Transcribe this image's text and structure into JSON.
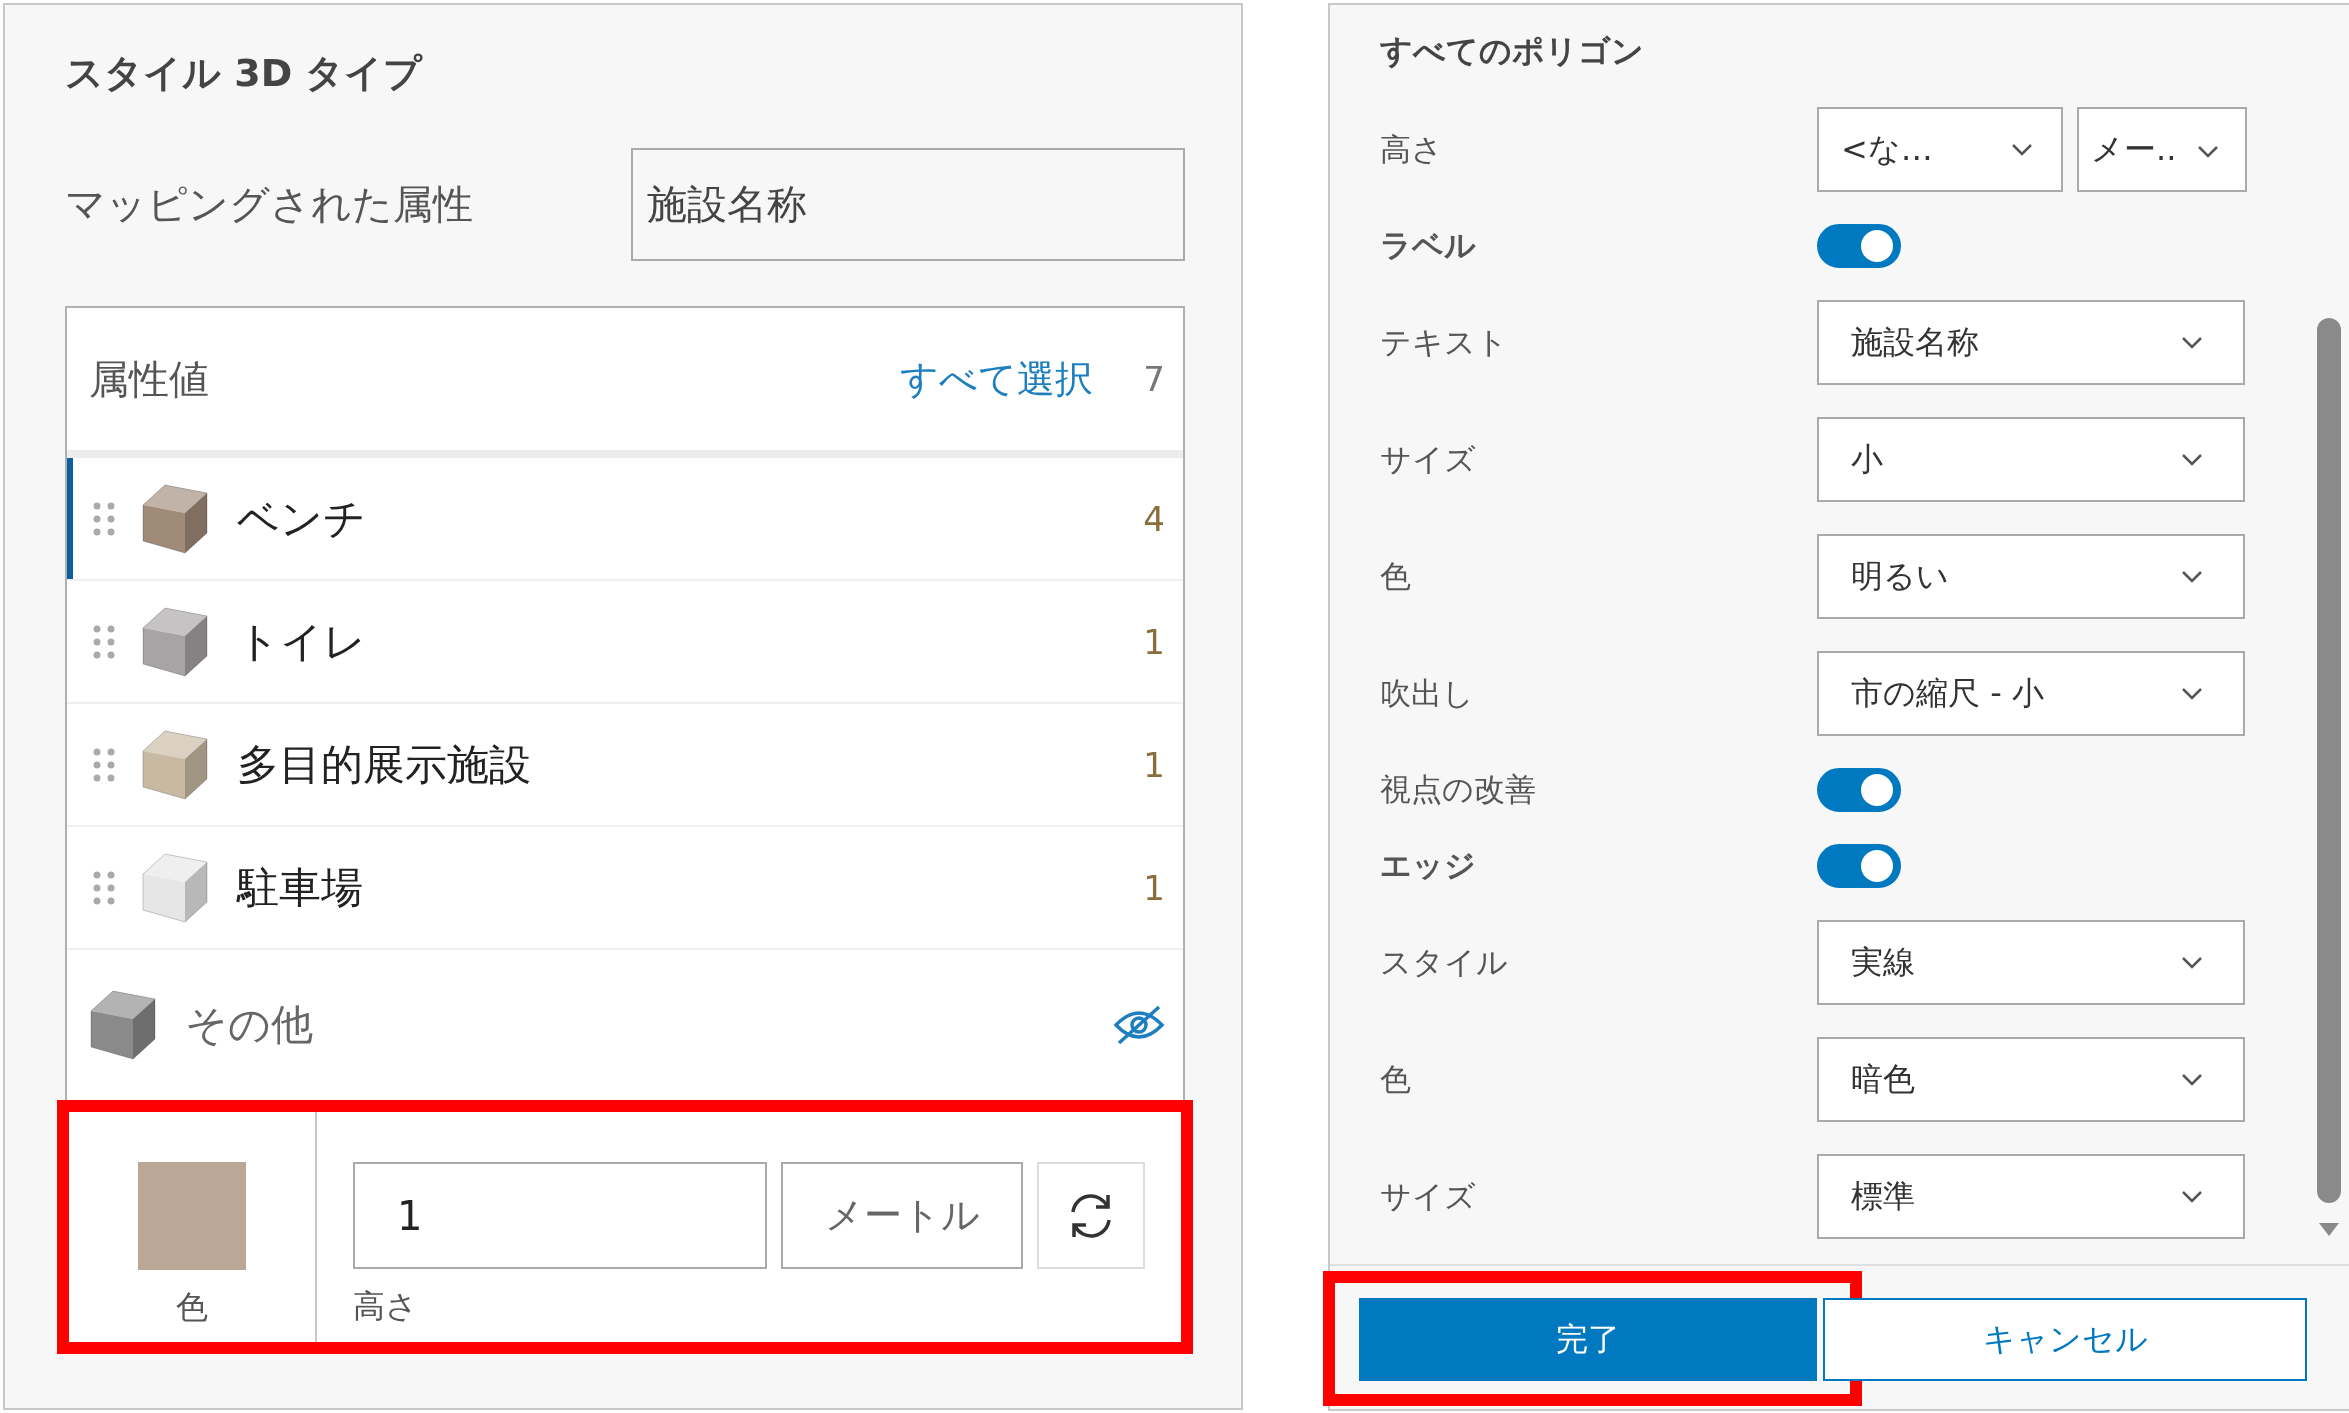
{
  "style_panel": {
    "title": "スタイル 3D タイプ",
    "mapped_attribute": {
      "label": "マッピングされた属性",
      "value": "施設名称"
    },
    "values_list": {
      "header": "属性値",
      "select_all": "すべて選択",
      "total": "7",
      "items": [
        {
          "label": "ベンチ",
          "count": "4",
          "color": "#a08a78",
          "selected": true
        },
        {
          "label": "トイレ",
          "count": "1",
          "color": "#a8a3a5",
          "selected": false
        },
        {
          "label": "多目的展示施設",
          "count": "1",
          "color": "#c8b9a3",
          "selected": false
        },
        {
          "label": "駐車場",
          "count": "1",
          "color": "#e6e6e6",
          "selected": false
        }
      ],
      "other": {
        "label": "その他",
        "color": "#8a8a8a",
        "hidden": true
      }
    },
    "editor": {
      "highlighted": true,
      "color": "#bba796",
      "color_label": "色",
      "height_value": "1",
      "unit": "メートル",
      "height_label": "高さ"
    }
  },
  "polygon_panel": {
    "title": "すべてのポリゴン",
    "rows": [
      {
        "kind": "dual_select",
        "label": "高さ",
        "values": [
          "<な…",
          "メー.."
        ]
      },
      {
        "kind": "section",
        "label": "ラベル",
        "on": true
      },
      {
        "kind": "select",
        "label": "テキスト",
        "value": "施設名称"
      },
      {
        "kind": "select",
        "label": "サイズ",
        "value": "小"
      },
      {
        "kind": "select",
        "label": "色",
        "value": "明るい"
      },
      {
        "kind": "select",
        "label": "吹出し",
        "value": "市の縮尺 - 小"
      },
      {
        "kind": "toggle",
        "label": "視点の改善",
        "on": true
      },
      {
        "kind": "section",
        "label": "エッジ",
        "on": true
      },
      {
        "kind": "select",
        "label": "スタイル",
        "value": "実線"
      },
      {
        "kind": "select",
        "label": "色",
        "value": "暗色"
      },
      {
        "kind": "select",
        "label": "サイズ",
        "value": "標準"
      }
    ],
    "buttons": [
      {
        "label": "完了",
        "primary": true,
        "highlighted": true
      },
      {
        "label": "キャンセル",
        "primary": false,
        "highlighted": false
      }
    ]
  }
}
